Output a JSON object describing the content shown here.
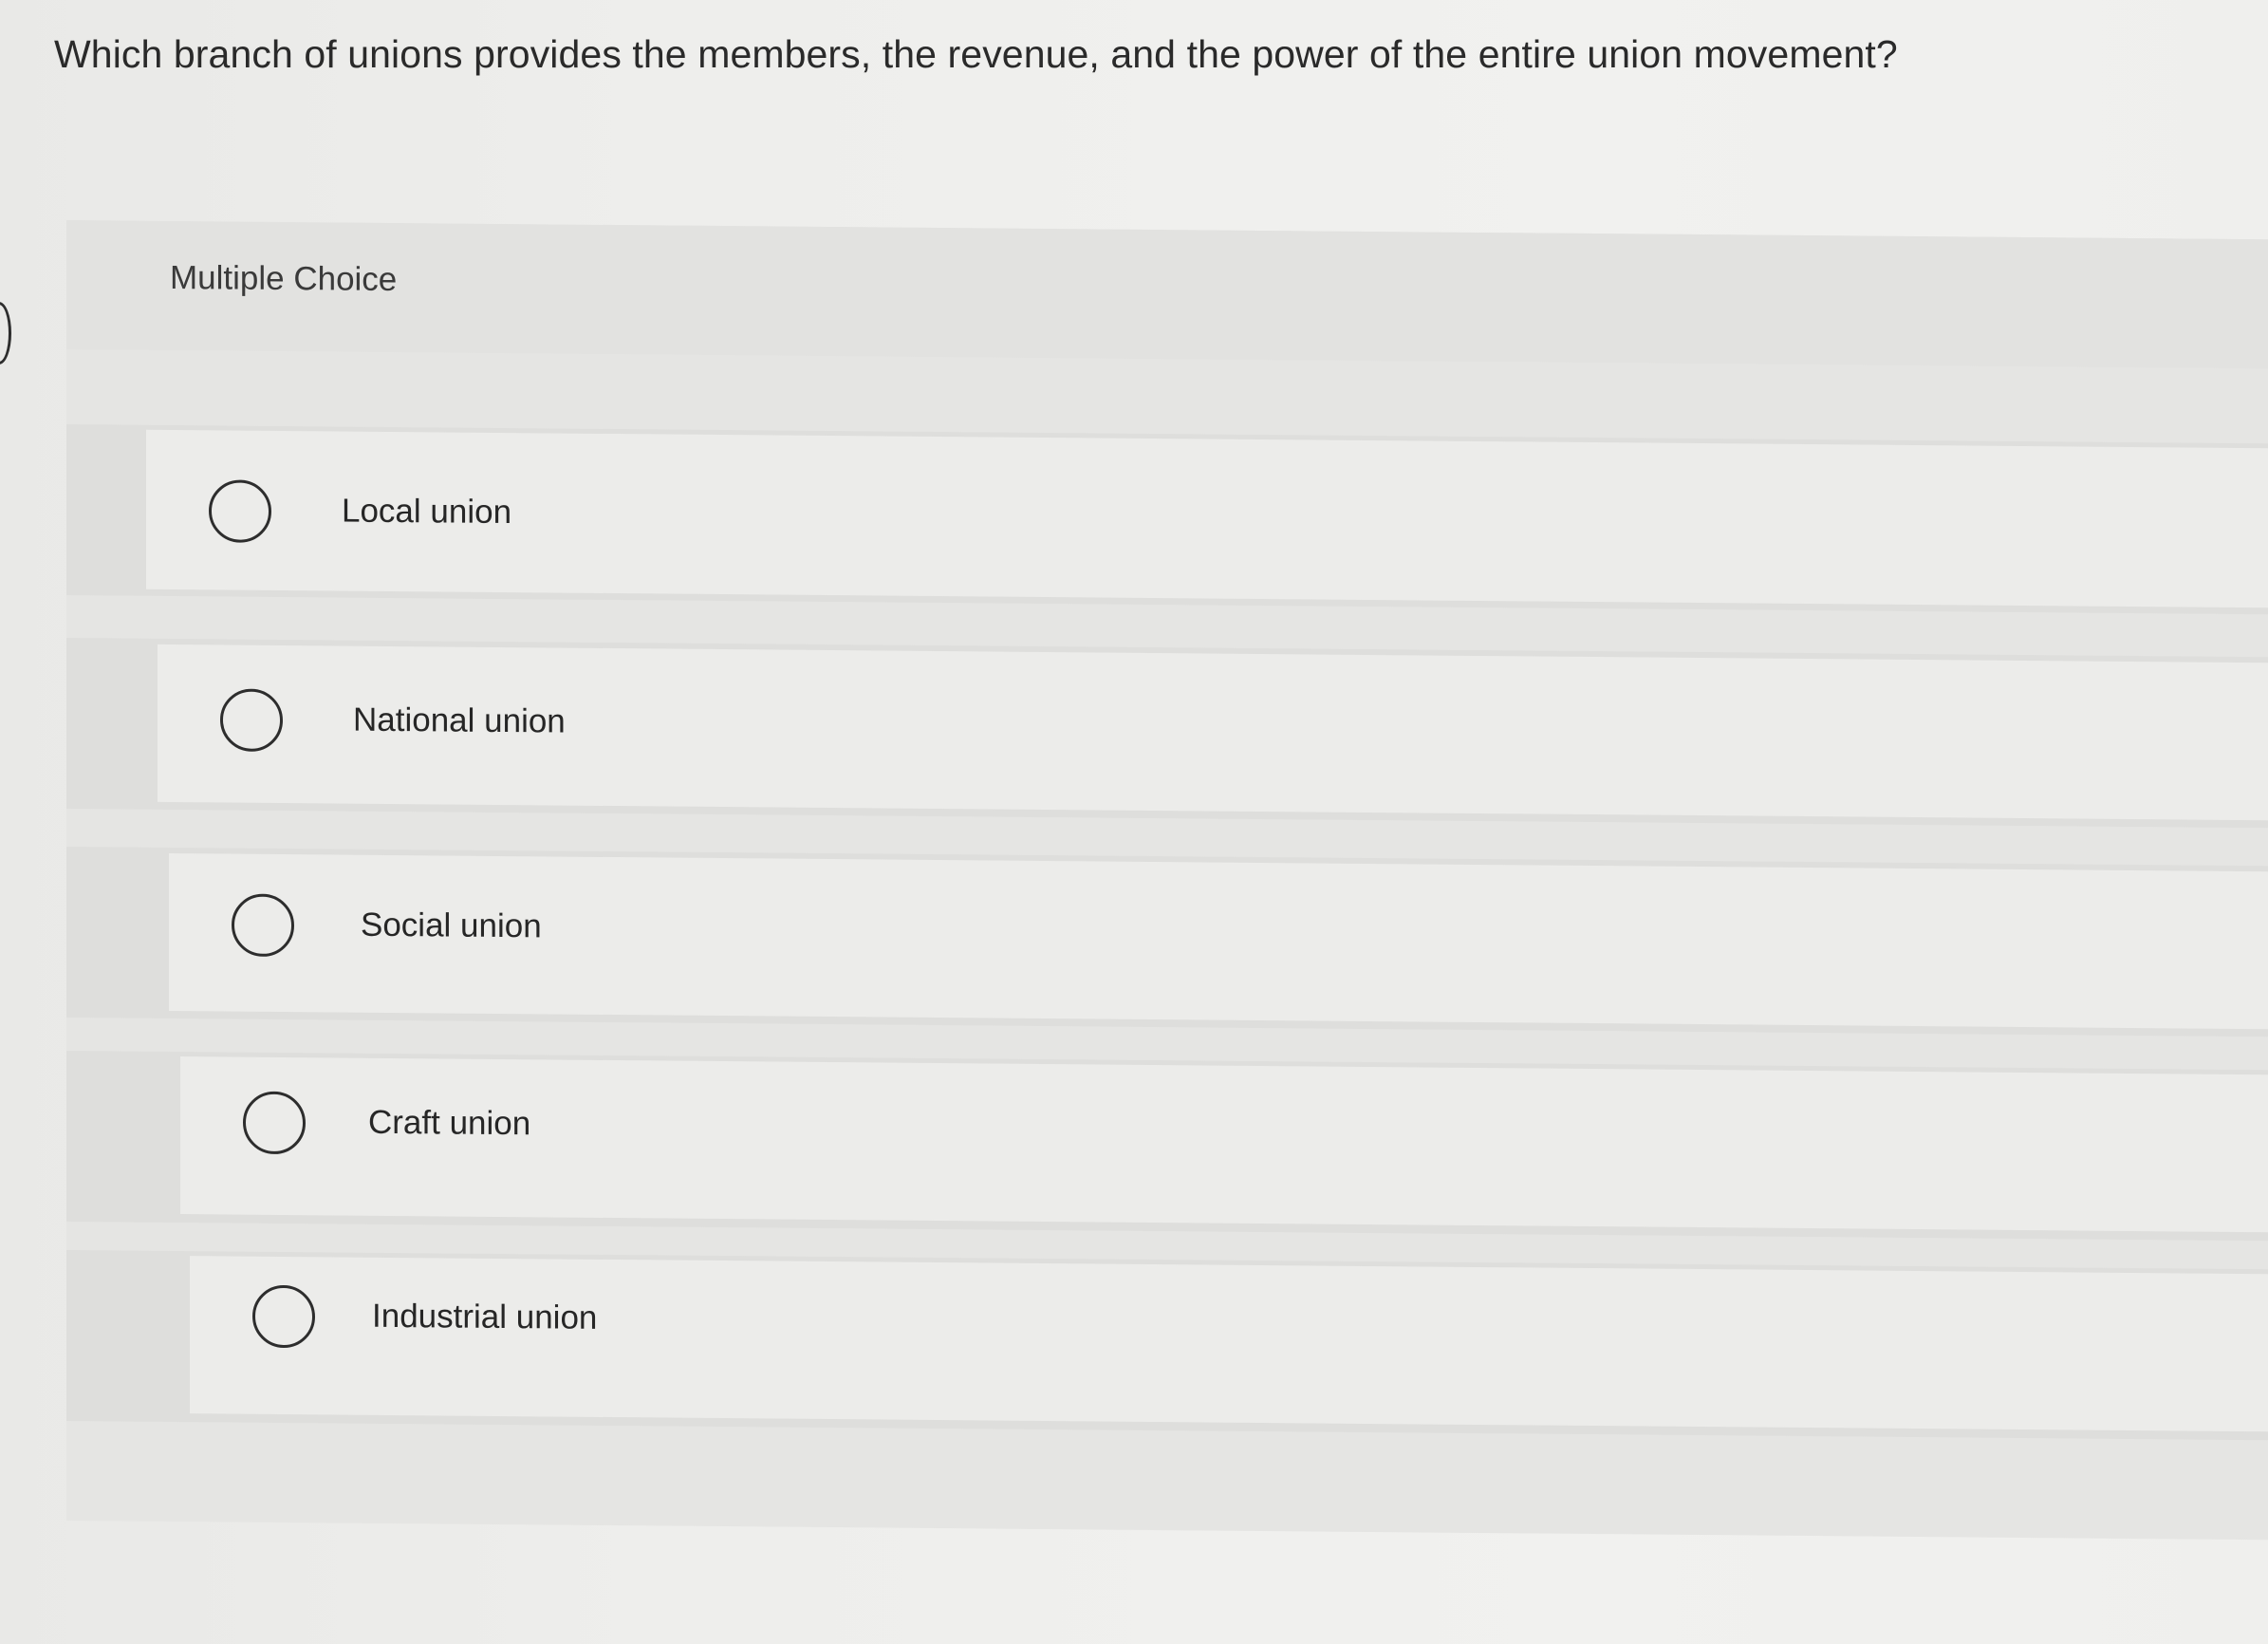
{
  "question": {
    "text": "Which branch of unions provides the members, the revenue, and the power of the entire union movement?"
  },
  "quiz": {
    "type_label": "Multiple Choice",
    "options": [
      {
        "label": "Local union",
        "selected": false
      },
      {
        "label": "National union",
        "selected": false
      },
      {
        "label": "Social union",
        "selected": false
      },
      {
        "label": "Craft union",
        "selected": false
      },
      {
        "label": "Industrial union",
        "selected": false
      }
    ]
  }
}
